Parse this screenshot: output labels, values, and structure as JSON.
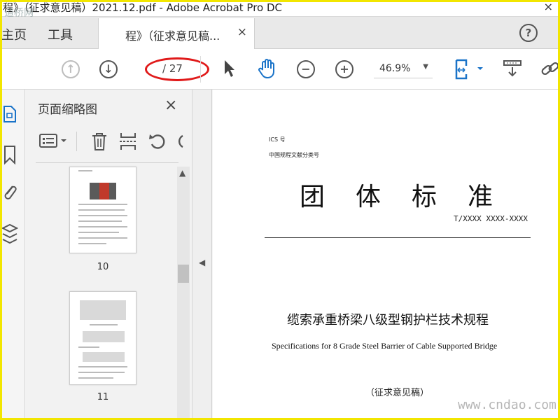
{
  "window": {
    "title": "程》（征求意见稿）2021.12.pdf - Adobe Acrobat Pro DC",
    "watermark_logo": "道桥网",
    "close_label": "×"
  },
  "tabs": {
    "home": "主页",
    "tools": "工具",
    "doc_tab_label": "程》（征求意见稿...",
    "doc_tab_close": "×",
    "help": "?"
  },
  "toolbar": {
    "page_input_value": "",
    "page_total": "/ 27",
    "zoom_value": "46.9%",
    "zoom_caret": "▼",
    "icons": {
      "prev": "arrow-up-icon",
      "next": "arrow-down-icon",
      "select": "pointer-icon",
      "hand": "hand-icon",
      "zoom_out": "zoom-out-icon",
      "zoom_in": "zoom-in-icon",
      "fit": "fit-page-icon",
      "scroll": "scroll-mode-icon",
      "link": "link-icon"
    },
    "highlight_color": "#e01a1a"
  },
  "rail": {
    "icons": [
      "page-thumbnails-icon",
      "bookmark-icon",
      "attachment-icon",
      "layers-icon"
    ],
    "accent": "#1a73c8"
  },
  "thumbnails": {
    "title": "页面缩略图",
    "close": "×",
    "pages": [
      {
        "label": "10"
      },
      {
        "label": "11"
      }
    ]
  },
  "document": {
    "ics": "ICS 号",
    "category": "中国规程文献分类号",
    "std_title": "团体标准",
    "std_code": "T/XXXX XXXX-XXXX",
    "cn_name": "缆索承重桥梁八级型钢护栏技术规程",
    "en_name": "Specifications for 8 Grade Steel Barrier of Cable Supported Bridge",
    "draft": "（征求意见稿）",
    "watermark": "www.cndao.com"
  },
  "colors": {
    "frame": "#f2e600"
  }
}
